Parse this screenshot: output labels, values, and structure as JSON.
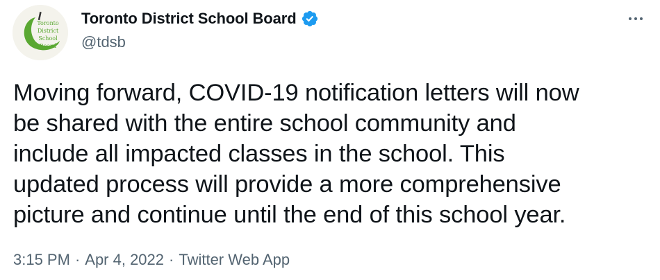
{
  "author": {
    "display_name": "Toronto District School Board",
    "handle": "@tdsb",
    "verified": true,
    "avatar_text_lines": [
      "Toronto",
      "District",
      "School",
      "Board"
    ]
  },
  "tweet": {
    "text_lines": [
      "Moving forward, COVID-19 notification letters will now",
      "be shared with the entire school community and",
      "include all impacted classes in the school. This",
      "updated process will provide a more comprehensive",
      "picture and continue until the end of this school year."
    ]
  },
  "meta": {
    "time": "3:15 PM",
    "separator": "·",
    "date": "Apr 4, 2022",
    "source": "Twitter Web App"
  },
  "icons": {
    "verified": "verified-badge-icon",
    "more": "more-options-icon"
  },
  "colors": {
    "text_primary": "#0f1419",
    "text_secondary": "#536471",
    "verified_blue": "#1d9bf0",
    "avatar_green": "#5aa832"
  }
}
